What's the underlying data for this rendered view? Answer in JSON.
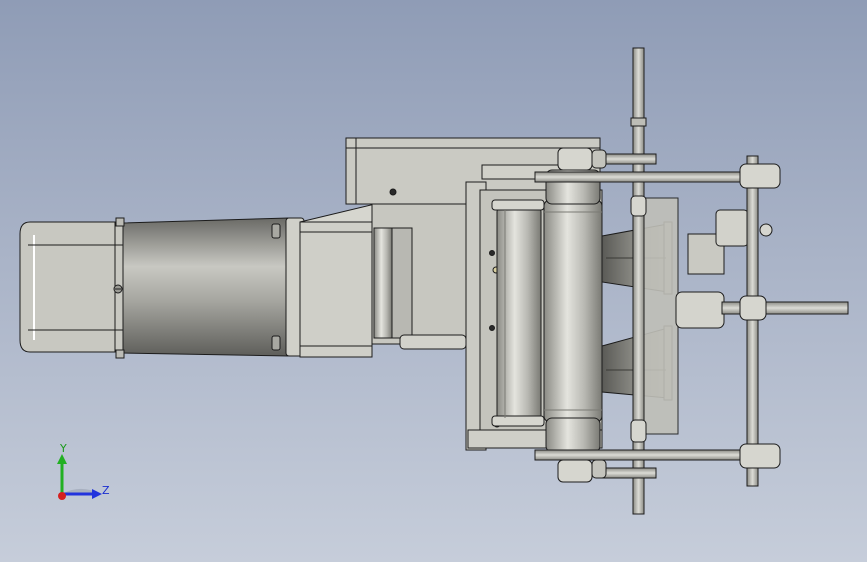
{
  "viewport": {
    "background_top": "#8f9cb6",
    "background_bottom": "#c6cdda",
    "part_color": "#c9c9c2",
    "edge_color": "#1c1c1c"
  },
  "triad": {
    "y_label": "Y",
    "z_label": "Z",
    "x_axis_color": "#d42020",
    "y_axis_color": "#22b022",
    "z_axis_color": "#2233dd"
  }
}
